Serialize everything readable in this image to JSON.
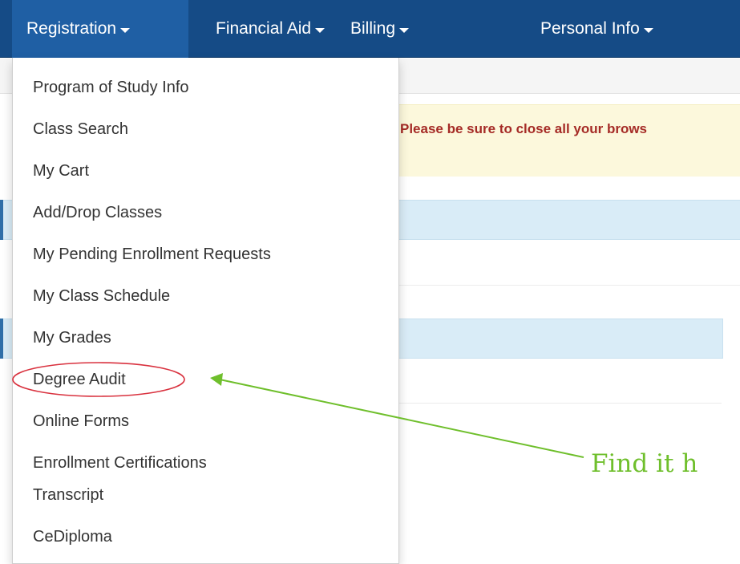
{
  "navbar": {
    "items": [
      {
        "label": "Registration"
      },
      {
        "label": "Financial Aid"
      },
      {
        "label": "Billing"
      },
      {
        "label": "Personal Info"
      }
    ]
  },
  "alert": {
    "text": "Please be sure to close all your brows"
  },
  "dropdown": {
    "items": [
      {
        "label": "Program of Study Info"
      },
      {
        "label": "Class Search"
      },
      {
        "label": "My Cart"
      },
      {
        "label": "Add/Drop Classes"
      },
      {
        "label": "My Pending Enrollment Requests"
      },
      {
        "label": "My Class Schedule"
      },
      {
        "label": "My Grades"
      },
      {
        "label": "Degree Audit"
      },
      {
        "label": "Online Forms"
      },
      {
        "label": "Enrollment Certifications"
      },
      {
        "label": "Transcript"
      },
      {
        "label": "CeDiploma"
      }
    ]
  },
  "annotation": {
    "text": "Find it h",
    "highlight_color": "#d9323f",
    "arrow_color": "#6fbf2c"
  },
  "colors": {
    "navbar": "#154b86",
    "navbar_active": "#1f5fa4",
    "alert_bg": "#fcf8dc",
    "alert_text": "#a52b26",
    "panel_bg": "#d9ecf7"
  }
}
